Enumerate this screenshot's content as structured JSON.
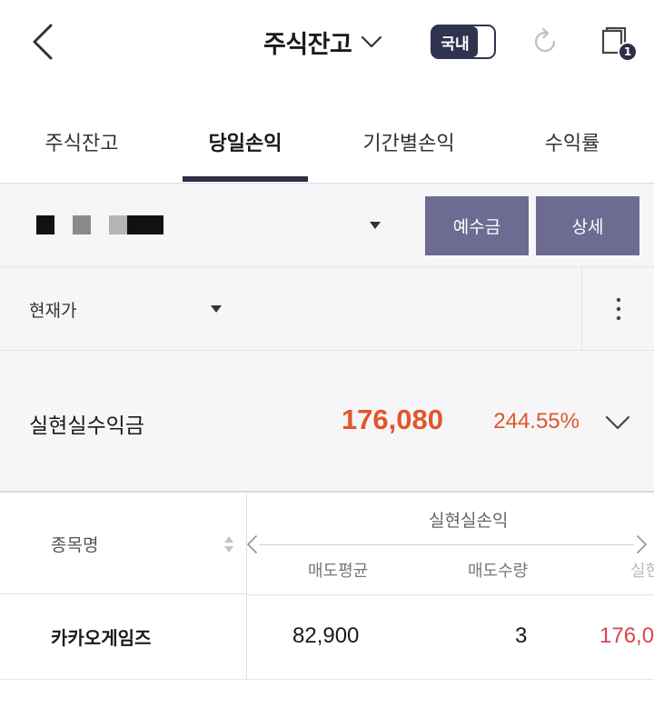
{
  "header": {
    "title": "주식잔고",
    "toggle_label": "국내",
    "window_badge_count": "1",
    "icons": {
      "back": "back-chevron-icon",
      "title_dropdown": "chevron-down-icon",
      "refresh": "refresh-icon",
      "windows": "windows-icon"
    }
  },
  "tabs": [
    {
      "label": "주식잔고",
      "active": false
    },
    {
      "label": "당일손익",
      "active": true
    },
    {
      "label": "기간별손익",
      "active": false
    },
    {
      "label": "수익률",
      "active": false
    }
  ],
  "account": {
    "masked": true,
    "deposit_button": "예수금",
    "detail_button": "상세"
  },
  "sort": {
    "selected": "현재가"
  },
  "summary": {
    "label": "실현실수익금",
    "amount": "176,080",
    "rate": "244.55%"
  },
  "table": {
    "name_header": "종목명",
    "group_header": "실현실손익",
    "columns": [
      "매도평균",
      "매도수량",
      "실현"
    ],
    "rows": [
      {
        "name": "카카오게임즈",
        "avg_sell_price": "82,900",
        "sell_qty": "3",
        "realized": "176,0"
      }
    ]
  },
  "colors": {
    "primary_dark": "#2c2f45",
    "button_purple": "#6d6b92",
    "profit_orange": "#e2552c",
    "profit_red": "#d9434f",
    "panel_bg": "#f6f6f8"
  }
}
